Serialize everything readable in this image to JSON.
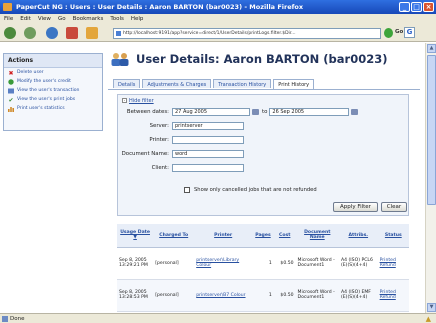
{
  "window": {
    "title": "PaperCut NG : Users : User Details : Aaron BARTON (bar0023) - Mozilla Firefox"
  },
  "menu": [
    "File",
    "Edit",
    "View",
    "Go",
    "Bookmarks",
    "Tools",
    "Help"
  ],
  "browser": {
    "url": "http://localhost:9191/app?service=direct/1/UserDetails/printLogs.filter.$Dir...",
    "go_label": "Go"
  },
  "sidebar": {
    "title": "Actions",
    "items": [
      {
        "label": "Delete user",
        "icon": "delete-x-icon"
      },
      {
        "label": "Modify the user's credit",
        "icon": "credit-icon"
      },
      {
        "label": "View the user's transaction",
        "icon": "transactions-icon"
      },
      {
        "label": "View the user's print jobs",
        "icon": "print-jobs-icon"
      },
      {
        "label": "Print user's statistics",
        "icon": "statistics-icon"
      }
    ]
  },
  "page": {
    "title": "User Details: Aaron BARTON (bar0023)",
    "tabs": [
      "Details",
      "Adjustments & Charges",
      "Transaction History",
      "Print History"
    ],
    "active_tab": 3
  },
  "filter": {
    "toggle_label": "Hide filter",
    "between_label": "Between dates:",
    "from_date": "27 Aug 2005",
    "to_label": "to",
    "to_date": "26 Sep 2005",
    "server_label": "Server:",
    "server_value": "printserver",
    "printer_label": "Printer:",
    "printer_value": "",
    "docname_label": "Document Name:",
    "docname_value": "word",
    "client_label": "Client:",
    "client_value": "",
    "checkbox_label": "Show only cancelled jobs that are not refunded",
    "apply_label": "Apply Filter",
    "clear_label": "Clear"
  },
  "table": {
    "columns": [
      "Usage Date",
      "Charged To",
      "Printer",
      "Pages",
      "Cost",
      "Document Name",
      "Attribs.",
      "Status"
    ],
    "rows": [
      {
        "date": "Sep 8, 2005 13:29:21 PM",
        "charged": "[personal]",
        "printer": "printserver\\Library Colour",
        "pages": "1",
        "cost": "$0.50",
        "doc": "Microsoft Word - Document1",
        "attribs": "A4 (ISO) PCL6 (E)(S)(4+4)",
        "status": "Printed Refund"
      },
      {
        "date": "Sep 8, 2005 13:28:53 PM",
        "charged": "[personal]",
        "printer": "printserver\\B7 Colour",
        "pages": "1",
        "cost": "$0.50",
        "doc": "Microsoft Word - Document1",
        "attribs": "A4 (ISO) EMF (E)(S)(4+4)",
        "status": "Printed Refund"
      }
    ]
  },
  "status": {
    "text": "Done"
  }
}
